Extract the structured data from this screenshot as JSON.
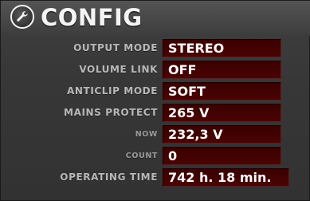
{
  "header": {
    "icon": "wrench-icon",
    "title": "CONFIG"
  },
  "settings": [
    {
      "label": "OUTPUT MODE",
      "value": "STEREO"
    },
    {
      "label": "VOLUME LINK",
      "value": "OFF"
    },
    {
      "label": "ANTICLIP MODE",
      "value": "SOFT"
    },
    {
      "label": "MAINS PROTECT",
      "value": "265 V"
    },
    {
      "label": "NOW",
      "value": "232,3 V"
    },
    {
      "label": "COUNT",
      "value": "0"
    },
    {
      "label": "OPERATING TIME",
      "value": "742 h. 18 min."
    }
  ],
  "colors": {
    "panel_bg": "#373737",
    "label_text": "#b8b8b8",
    "value_bg": "#420202",
    "value_text": "#ffffff"
  }
}
